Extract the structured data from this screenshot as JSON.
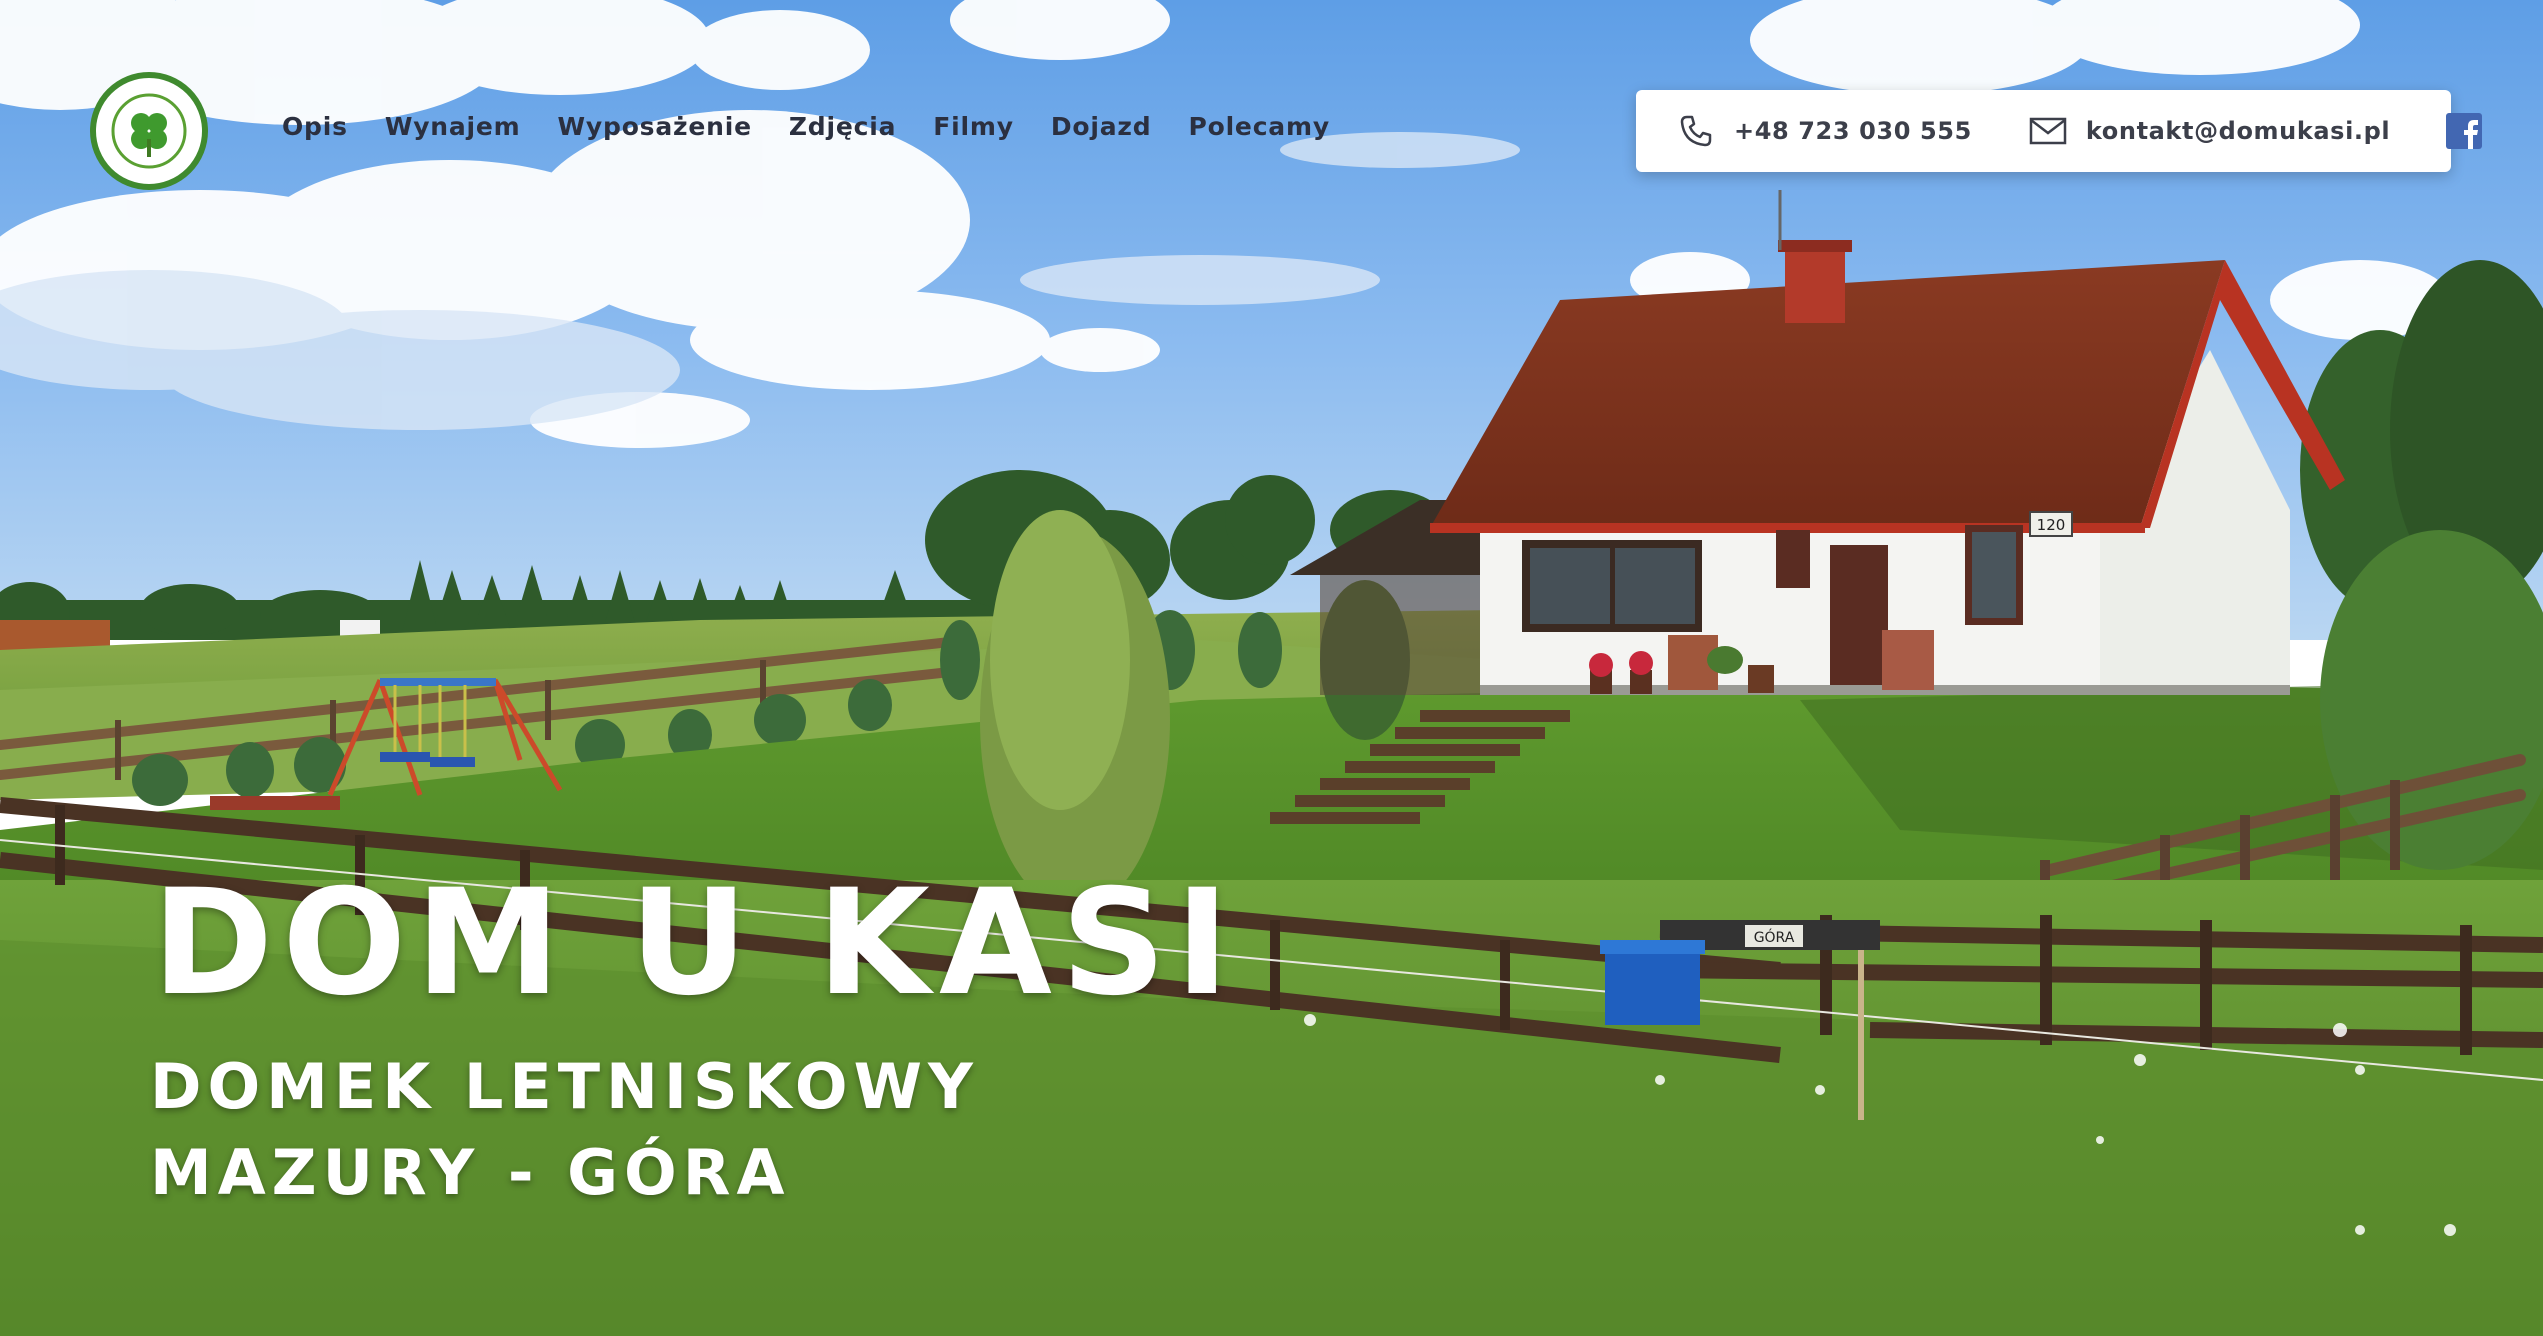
{
  "logo": {
    "alt": "Dom u Kasi logo",
    "icon": "clover-icon",
    "ring_color": "#3f8a2e"
  },
  "nav": {
    "items": [
      {
        "label": "Opis"
      },
      {
        "label": "Wynajem"
      },
      {
        "label": "Wyposażenie"
      },
      {
        "label": "Zdjęcia"
      },
      {
        "label": "Filmy"
      },
      {
        "label": "Dojazd"
      },
      {
        "label": "Polecamy"
      }
    ]
  },
  "contact": {
    "phone": "+48 723 030 555",
    "phone_icon": "phone-icon",
    "email": "kontakt@domukasi.pl",
    "email_icon": "mail-icon",
    "social_icon": "facebook-icon",
    "social_color": "#4267b2"
  },
  "hero": {
    "title": "DOM U KASI",
    "subtitle_line1": "DOMEK LETNISKOWY",
    "subtitle_line2": "MAZURY - GÓRA"
  },
  "scene": {
    "house_number": "120",
    "sign_text": "GÓRA"
  }
}
